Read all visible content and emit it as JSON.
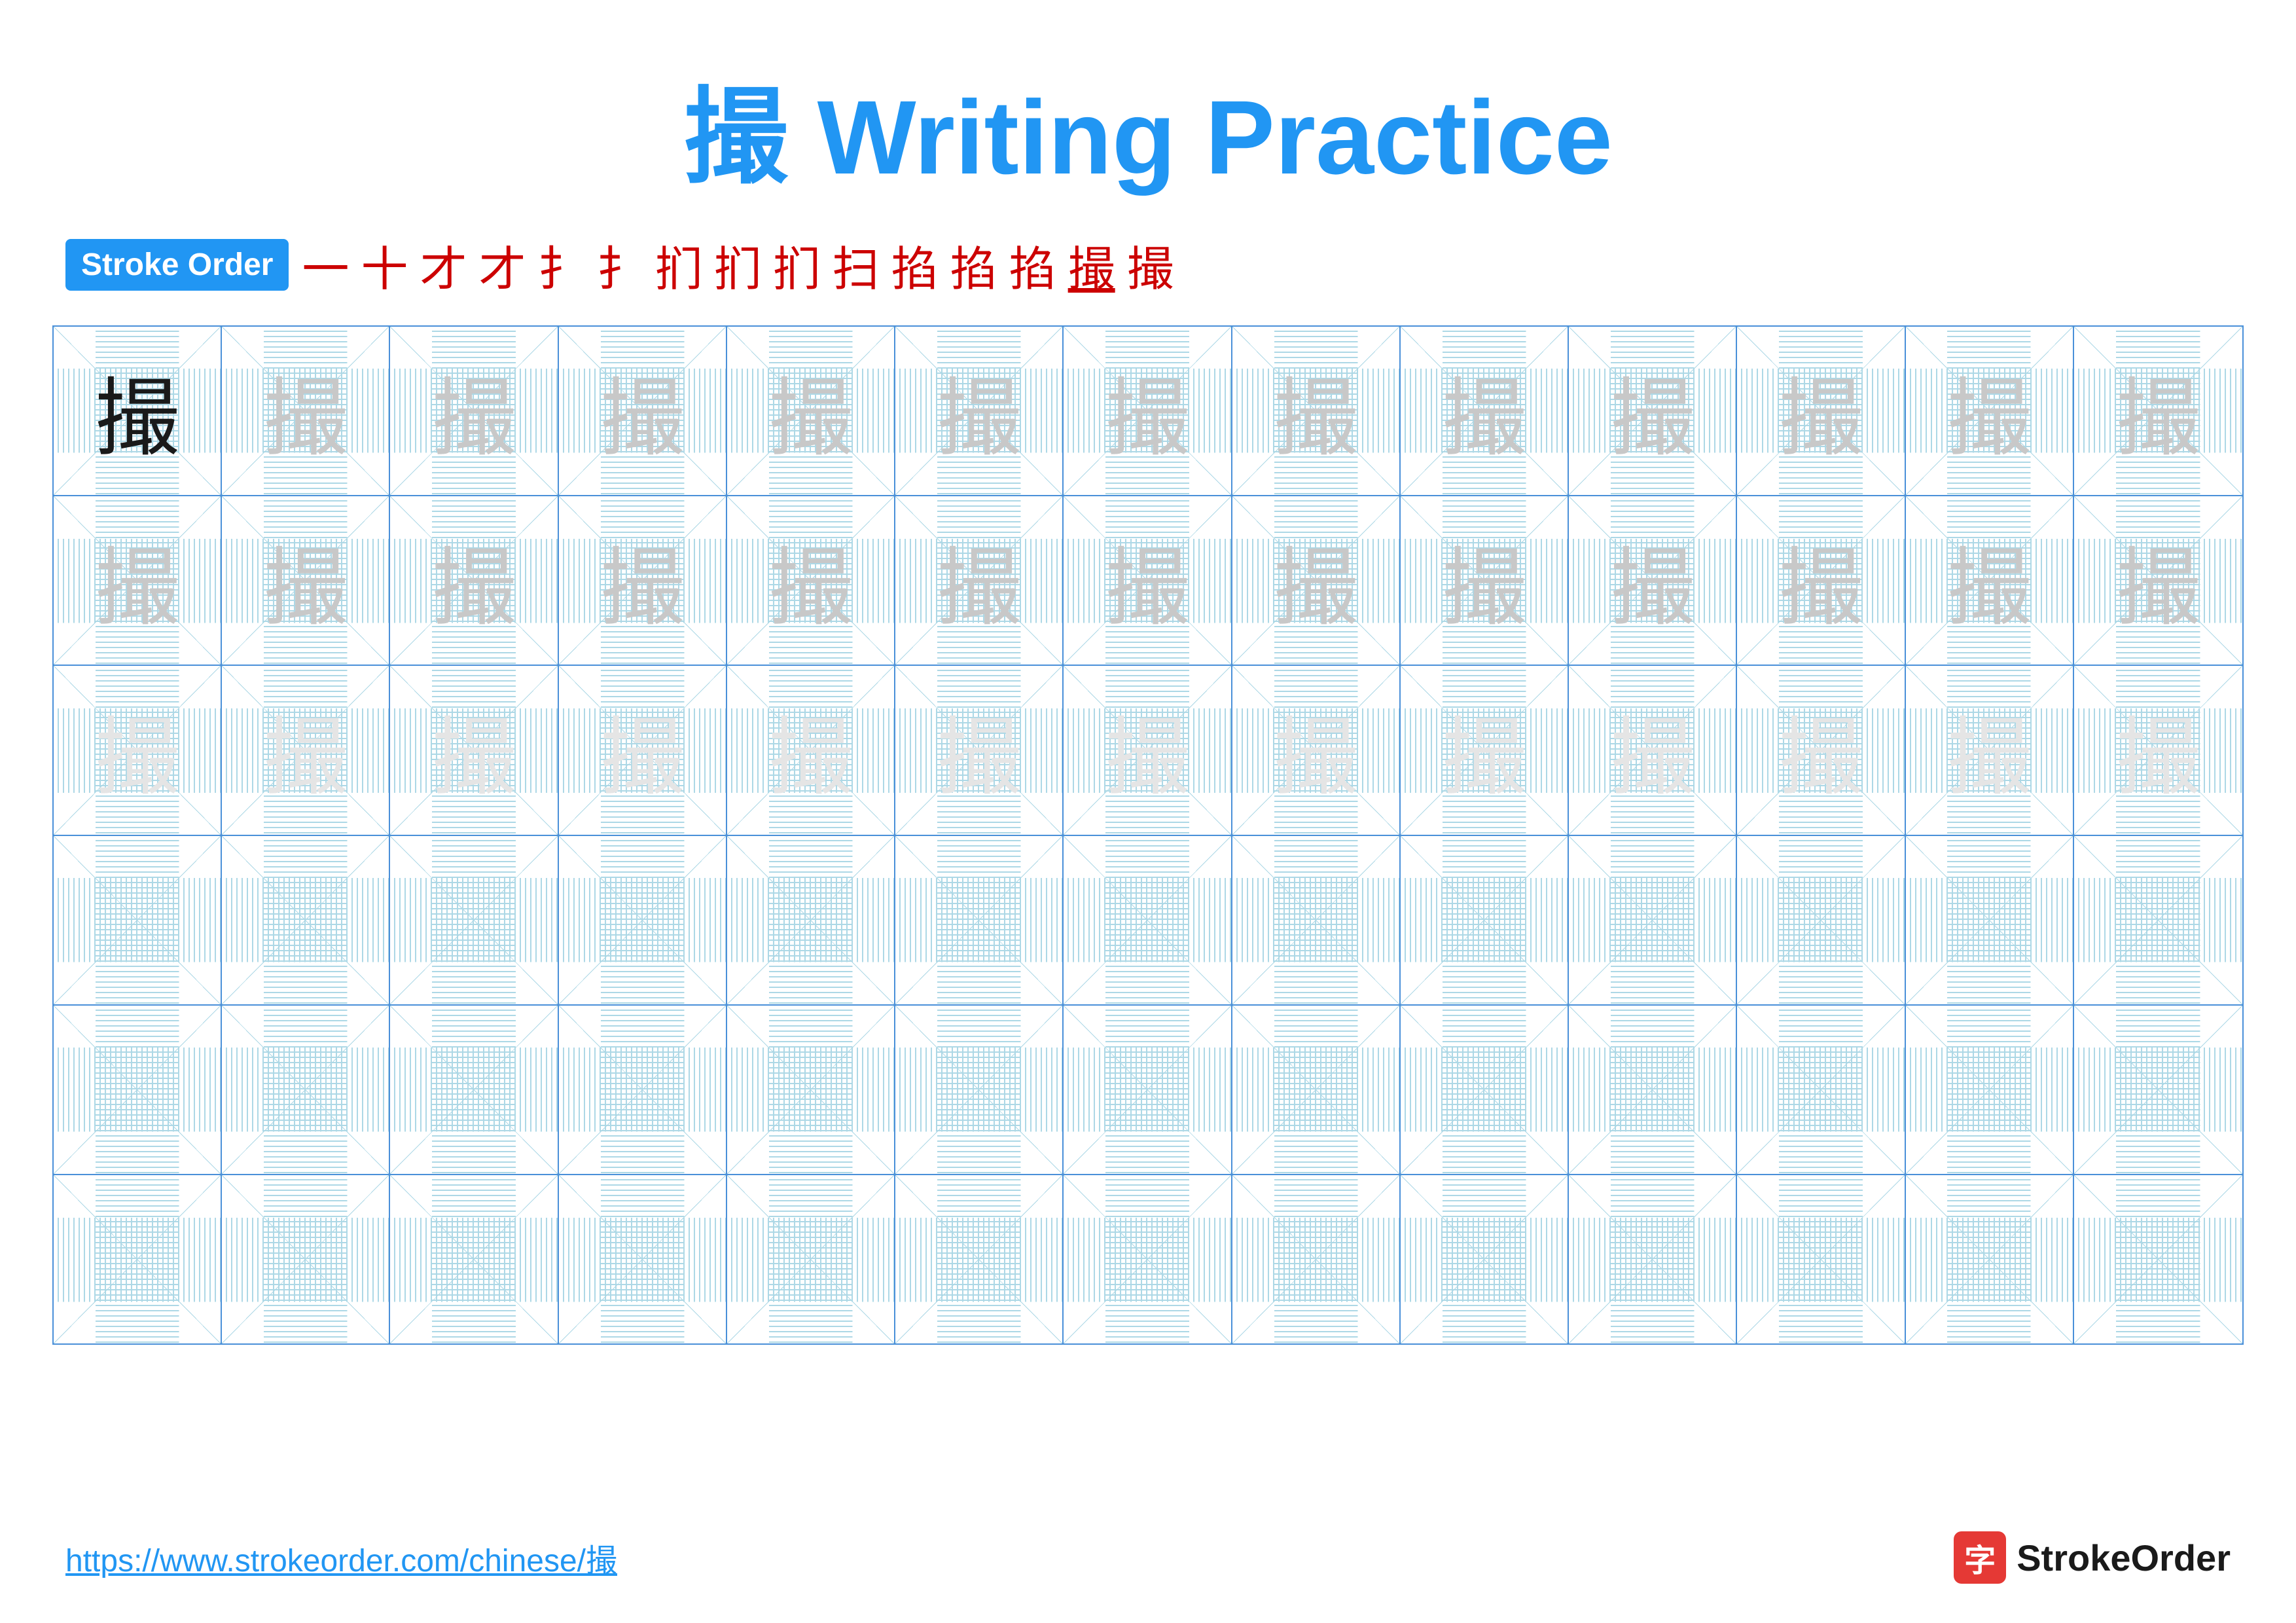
{
  "title": {
    "char": "撮",
    "label": " Writing Practice",
    "full": "撮 Writing Practice"
  },
  "stroke_order": {
    "badge": "Stroke Order",
    "sequence": [
      "一",
      "十",
      "才",
      "才",
      "扌",
      "扌",
      "扪",
      "扪",
      "扪",
      "扫",
      "掐",
      "掐",
      "掐",
      "撮",
      "撮"
    ]
  },
  "grid": {
    "rows": 6,
    "cols": 13,
    "char": "撮",
    "row1_shade": "dark",
    "row2_shade": "light1",
    "row3_shade": "light2",
    "row4_shade": "empty",
    "row5_shade": "empty",
    "row6_shade": "empty"
  },
  "footer": {
    "url": "https://www.strokeorder.com/chinese/撮",
    "logo_char": "字",
    "logo_name": "StrokeOrder"
  }
}
